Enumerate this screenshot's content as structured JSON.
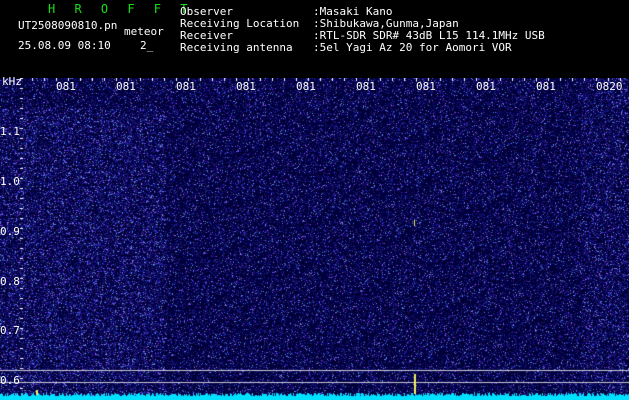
{
  "header": {
    "brand": "H R O F F T",
    "filename": "UT2508090810.pn",
    "tag": "meteor",
    "datetime": "25.08.09 08:10",
    "duration": "2_",
    "observer_label": "Observer",
    "observer_value": ":Masaki Kano",
    "location_label": "Receiving Location",
    "location_value": ":Shibukawa,Gunma,Japan",
    "receiver_label": "Receiver",
    "receiver_value": ":RTL-SDR SDR# 43dB L15 114.1MHz USB",
    "antenna_label": "Receiving antenna",
    "antenna_value": ":5el Yagi Az 20 for Aomori VOR"
  },
  "axis": {
    "unit": "kHz",
    "y_ticks": [
      "1.1",
      "1.0",
      "0.9",
      "0.8",
      "0.7",
      "0.6"
    ],
    "x_ticks": [
      "081",
      "081",
      "081",
      "081",
      "081",
      "081",
      "081",
      "081",
      "081",
      "0820"
    ]
  },
  "colors": {
    "background": "#000000",
    "noise": "#1a28b8",
    "signal": "#f0f060",
    "baseline": "#00e0ff",
    "brand": "#18e018"
  }
}
